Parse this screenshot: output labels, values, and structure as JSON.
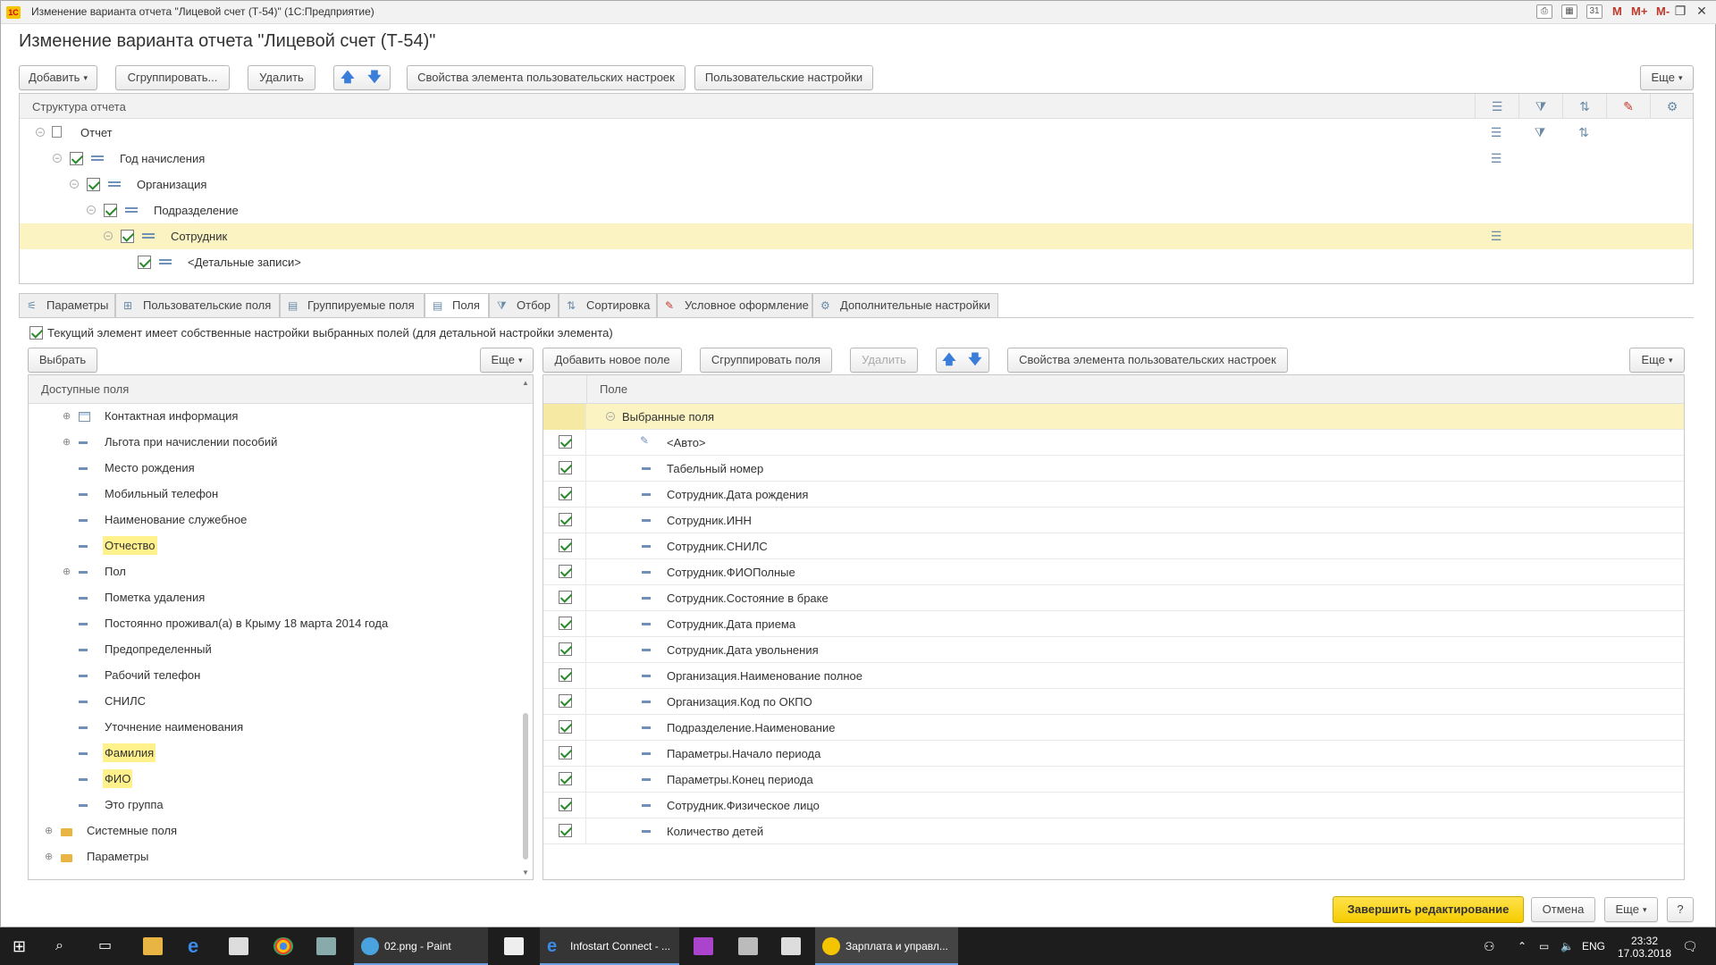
{
  "window": {
    "title": "Изменение варианта отчета \"Лицевой счет (Т-54)\"  (1С:Предприятие)",
    "toolbar_texts": [
      "M",
      "M+",
      "M-"
    ]
  },
  "form_title": "Изменение варианта отчета \"Лицевой счет (Т-54)\"",
  "top_toolbar": {
    "add": "Добавить",
    "group": "Сгруппировать...",
    "delete": "Удалить",
    "element_props": "Свойства элемента пользовательских настроек",
    "user_settings": "Пользовательские настройки",
    "more": "Еще"
  },
  "structure": {
    "header": "Структура отчета",
    "rows": [
      {
        "label": "Отчет",
        "checked": false
      },
      {
        "label": "Год начисления",
        "checked": true
      },
      {
        "label": "Организация",
        "checked": true
      },
      {
        "label": "Подразделение",
        "checked": true
      },
      {
        "label": "Сотрудник",
        "checked": true,
        "selected": true
      },
      {
        "label": "<Детальные записи>",
        "checked": true
      }
    ]
  },
  "tabs": [
    {
      "label": "Параметры"
    },
    {
      "label": "Пользовательские поля"
    },
    {
      "label": "Группируемые поля"
    },
    {
      "label": "Поля",
      "active": true
    },
    {
      "label": "Отбор"
    },
    {
      "label": "Сортировка"
    },
    {
      "label": "Условное оформление"
    },
    {
      "label": "Дополнительные настройки"
    }
  ],
  "own_settings_checkbox": "Текущий элемент имеет собственные настройки выбранных полей (для детальной настройки элемента)",
  "left_panel": {
    "select": "Выбрать",
    "more": "Еще",
    "header": "Доступные поля",
    "items": [
      {
        "label": "Контактная информация",
        "expandable": true,
        "icon": "table-icon"
      },
      {
        "label": "Льгота при начислении пособий",
        "expandable": true,
        "icon": "field-icon"
      },
      {
        "label": "Место рождения",
        "icon": "field-icon"
      },
      {
        "label": "Мобильный телефон",
        "icon": "field-icon"
      },
      {
        "label": "Наименование служебное",
        "icon": "field-icon"
      },
      {
        "label": "Отчество",
        "icon": "field-icon",
        "highlight": true
      },
      {
        "label": "Пол",
        "expandable": true,
        "icon": "field-icon"
      },
      {
        "label": "Пометка удаления",
        "icon": "field-icon"
      },
      {
        "label": "Постоянно проживал(а) в Крыму 18 марта 2014 года",
        "icon": "field-icon"
      },
      {
        "label": "Предопределенный",
        "icon": "field-icon"
      },
      {
        "label": "Рабочий телефон",
        "icon": "field-icon"
      },
      {
        "label": "СНИЛС",
        "icon": "field-icon"
      },
      {
        "label": "Уточнение наименования",
        "icon": "field-icon"
      },
      {
        "label": "Фамилия",
        "icon": "field-icon",
        "highlight": true
      },
      {
        "label": "ФИО",
        "icon": "field-icon",
        "highlight": true
      },
      {
        "label": "Это группа",
        "icon": "field-icon"
      },
      {
        "label": "Системные поля",
        "expandable": true,
        "icon": "folder-icon",
        "level": 0
      },
      {
        "label": "Параметры",
        "expandable": true,
        "icon": "folder-icon",
        "level": 0
      }
    ]
  },
  "right_panel": {
    "add_field": "Добавить новое поле",
    "group_fields": "Сгруппировать поля",
    "delete": "Удалить",
    "element_props": "Свойства элемента пользовательских настроек",
    "more": "Еще",
    "header": "Поле",
    "group_row": "Выбранные поля",
    "items": [
      {
        "label": "<Авто>",
        "icon": "auto-icon"
      },
      {
        "label": "Табельный номер"
      },
      {
        "label": "Сотрудник.Дата рождения"
      },
      {
        "label": "Сотрудник.ИНН"
      },
      {
        "label": "Сотрудник.СНИЛС"
      },
      {
        "label": "Сотрудник.ФИОПолные"
      },
      {
        "label": "Сотрудник.Состояние в браке"
      },
      {
        "label": "Сотрудник.Дата приема"
      },
      {
        "label": "Сотрудник.Дата увольнения"
      },
      {
        "label": "Организация.Наименование полное"
      },
      {
        "label": "Организация.Код по ОКПО"
      },
      {
        "label": "Подразделение.Наименование"
      },
      {
        "label": "Параметры.Начало периода"
      },
      {
        "label": "Параметры.Конец периода"
      },
      {
        "label": "Сотрудник.Физическое лицо"
      },
      {
        "label": "Количество детей"
      }
    ]
  },
  "footer": {
    "finish": "Завершить редактирование",
    "cancel": "Отмена",
    "more": "Еще",
    "help": "?"
  },
  "taskbar": {
    "items": [
      "02.png - Paint",
      "Infostart Connect - ...",
      "Зарплата и управл..."
    ],
    "lang": "ENG",
    "time": "23:32",
    "date": "17.03.2018"
  },
  "colors": {
    "accent_yellow": "#f5cc00",
    "selection": "#fbf3c2",
    "highlight": "#fff18c",
    "checkmark": "#2a8a2a"
  }
}
